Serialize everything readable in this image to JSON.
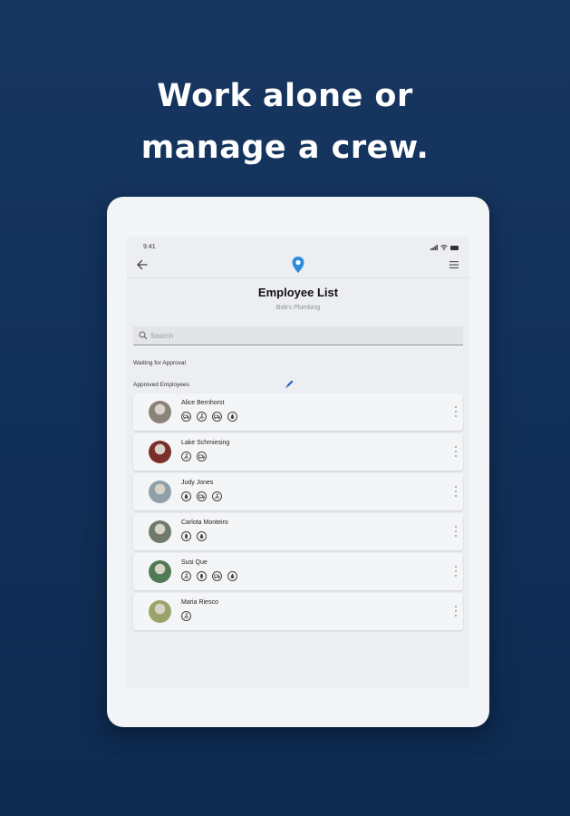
{
  "headline": {
    "line1": "Work alone or",
    "line2": "manage a crew."
  },
  "device": {
    "status": {
      "time": "9:41"
    },
    "app": {
      "title": "Employee List",
      "subtitle": "Bob's Plumbing",
      "search": {
        "placeholder": "Search",
        "value": ""
      },
      "sections": {
        "waiting": "Waiting for Approval",
        "approved": "Approved Employees"
      },
      "employees": [
        {
          "name": "Alice Bernhorst",
          "avatar_color": "#8a8378",
          "badges": [
            "truck-icon",
            "person-icon",
            "truck-icon",
            "drop-icon"
          ]
        },
        {
          "name": "Lake Schmiesing",
          "avatar_color": "#7a2f2a",
          "badges": [
            "person-icon",
            "truck-icon"
          ]
        },
        {
          "name": "Judy Jones",
          "avatar_color": "#8fa0a8",
          "badges": [
            "drop-icon",
            "truck-icon",
            "person-icon"
          ]
        },
        {
          "name": "Carlota Monteiro",
          "avatar_color": "#6f7a6c",
          "badges": [
            "leaf-icon",
            "drop-icon"
          ]
        },
        {
          "name": "Susi Que",
          "avatar_color": "#4f7a52",
          "badges": [
            "person-icon",
            "leaf-icon",
            "truck-icon",
            "drop-icon"
          ]
        },
        {
          "name": "Maria Riesco",
          "avatar_color": "#9aa46a",
          "badges": [
            "person-icon"
          ]
        }
      ]
    }
  },
  "colors": {
    "background": "#12315b",
    "accent": "#2a8be0",
    "edit": "#1f5fbf"
  }
}
